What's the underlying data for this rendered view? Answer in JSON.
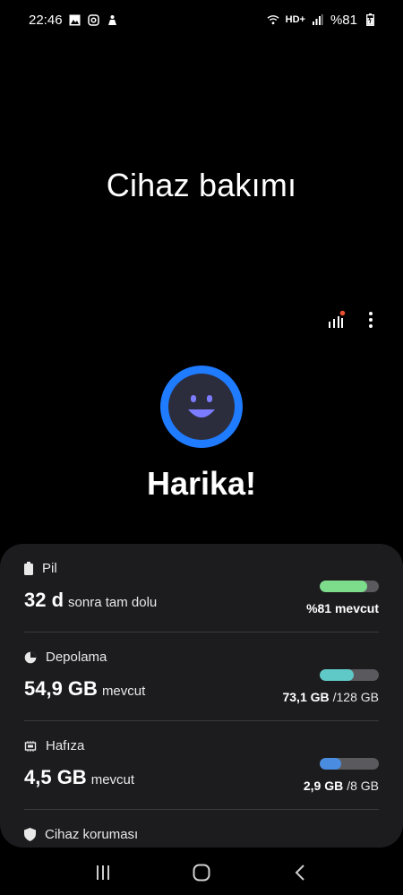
{
  "status_bar": {
    "time": "22:46",
    "network": "HD+",
    "battery": "%81"
  },
  "page": {
    "title": "Cihaz bakımı",
    "status": "Harika!"
  },
  "colors": {
    "accent": "#1f7bff",
    "battery_bar": "#7ddc8b",
    "storage_bar": "#5fc9c7",
    "memory_bar": "#4a8de0"
  },
  "items": [
    {
      "label": "Pil",
      "icon": "battery-icon",
      "value_big": "32 d",
      "value_small": "sonra tam dolu",
      "right_bold": "%81 mevcut",
      "right_light": "",
      "progress": 0.81
    },
    {
      "label": "Depolama",
      "icon": "storage-icon",
      "value_big": "54,9 GB",
      "value_small": "mevcut",
      "right_bold": "73,1 GB",
      "right_light": "/128 GB",
      "progress": 0.57
    },
    {
      "label": "Hafıza",
      "icon": "memory-chip-icon",
      "value_big": "4,5 GB",
      "value_small": "mevcut",
      "right_bold": "2,9 GB",
      "right_light": "/8 GB",
      "progress": 0.36
    },
    {
      "label": "Cihaz koruması",
      "icon": "shield-icon"
    }
  ]
}
